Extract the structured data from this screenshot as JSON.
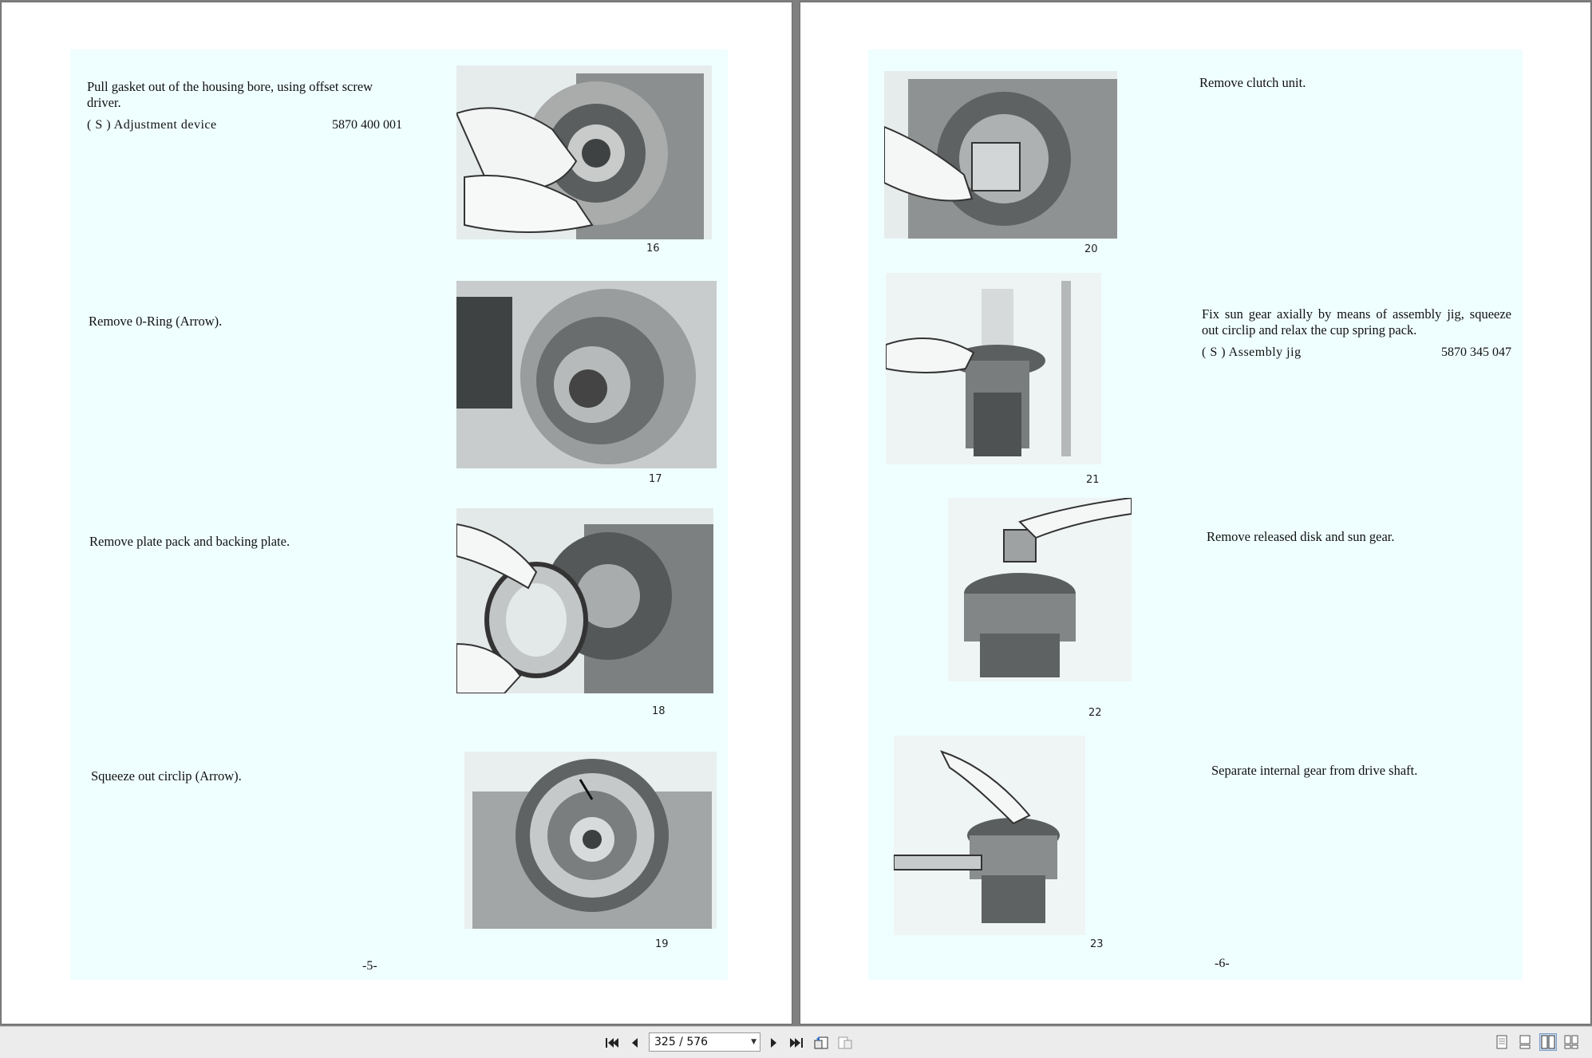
{
  "left_page": {
    "steps": [
      {
        "text": "Pull gasket out of the housing bore, using offset screw driver.",
        "tool_label": "( S )  Adjustment device",
        "tool_number": "5870 400 001",
        "figure": "16"
      },
      {
        "text": "Remove 0-Ring (Arrow).",
        "figure": "17"
      },
      {
        "text": "Remove plate pack and backing plate.",
        "figure": "18"
      },
      {
        "text": "Squeeze out circlip (Arrow).",
        "figure": "19"
      }
    ],
    "page_number": "-5-"
  },
  "right_page": {
    "steps": [
      {
        "text": "Remove clutch unit.",
        "figure": "20"
      },
      {
        "text": "Fix sun gear axially by means of assembly jig, squeeze out circlip and relax the cup spring pack.",
        "tool_label": "( S )  Assembly jig",
        "tool_number": "5870 345 047",
        "figure": "21"
      },
      {
        "text": "Remove released disk and sun gear.",
        "figure": "22"
      },
      {
        "text": "Separate internal gear from drive shaft.",
        "figure": "23"
      }
    ],
    "page_number": "-6-"
  },
  "toolbar": {
    "page_indicator": "325 / 576",
    "buttons": [
      "first-page-icon",
      "previous-page-icon",
      "next-page-icon",
      "last-page-icon",
      "previous-view-icon",
      "next-view-icon"
    ],
    "view_modes": [
      "single-page-icon",
      "single-continuous-icon",
      "two-page-icon",
      "two-page-continuous-icon"
    ],
    "active_view_mode": "two-page-icon"
  },
  "colors": {
    "sheet": "#effeff",
    "viewer_bg": "#7f7f7f",
    "toolbar_bg": "#ececec"
  }
}
